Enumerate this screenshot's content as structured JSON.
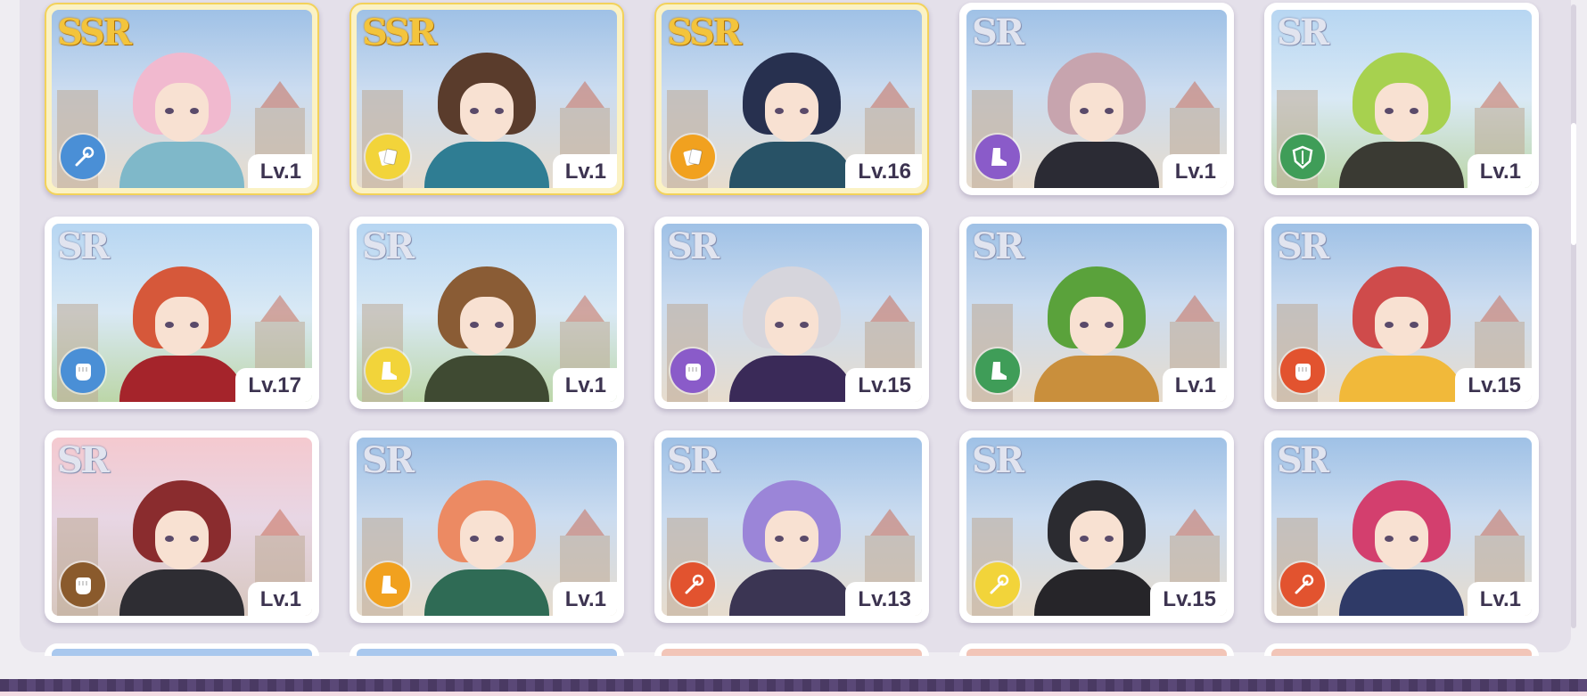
{
  "cards": [
    {
      "rarity": "SSR",
      "level": "Lv.1",
      "element": "blue",
      "role": "staff",
      "hair": "#f1b9cf",
      "outfit": "#7fb8c9",
      "bg": "sky"
    },
    {
      "rarity": "SSR",
      "level": "Lv.1",
      "element": "yellow",
      "role": "cards",
      "hair": "#5a3c2c",
      "outfit": "#2f7d93",
      "bg": "sky"
    },
    {
      "rarity": "SSR",
      "level": "Lv.16",
      "element": "orange",
      "role": "cards",
      "hair": "#27304f",
      "outfit": "#285266",
      "bg": "sky"
    },
    {
      "rarity": "SR",
      "level": "Lv.1",
      "element": "purple",
      "role": "boot",
      "hair": "#c7a4ae",
      "outfit": "#2b2b34",
      "bg": "sky"
    },
    {
      "rarity": "SR",
      "level": "Lv.1",
      "element": "green",
      "role": "shield",
      "hair": "#a7d14f",
      "outfit": "#3a3a33",
      "bg": "sky2"
    },
    {
      "rarity": "SR",
      "level": "Lv.17",
      "element": "blue",
      "role": "fist",
      "hair": "#d6583a",
      "outfit": "#a5242b",
      "bg": "sky2"
    },
    {
      "rarity": "SR",
      "level": "Lv.1",
      "element": "yellow",
      "role": "boot",
      "hair": "#8a5c35",
      "outfit": "#3f4a32",
      "bg": "sky2"
    },
    {
      "rarity": "SR",
      "level": "Lv.15",
      "element": "purple",
      "role": "fist",
      "hair": "#d6d5dc",
      "outfit": "#3a2a58",
      "bg": "sky"
    },
    {
      "rarity": "SR",
      "level": "Lv.1",
      "element": "green",
      "role": "boot",
      "hair": "#5aa23b",
      "outfit": "#c98f3c",
      "bg": "sky"
    },
    {
      "rarity": "SR",
      "level": "Lv.15",
      "element": "red",
      "role": "fist",
      "hair": "#cf4b4b",
      "outfit": "#f1b93a",
      "bg": "sky"
    },
    {
      "rarity": "SR",
      "level": "Lv.1",
      "element": "brown",
      "role": "fist",
      "hair": "#8a2c2e",
      "outfit": "#2e2d33",
      "bg": "warm"
    },
    {
      "rarity": "SR",
      "level": "Lv.1",
      "element": "orange",
      "role": "boot",
      "hair": "#ec8a63",
      "outfit": "#2f6b55",
      "bg": "sky"
    },
    {
      "rarity": "SR",
      "level": "Lv.13",
      "element": "red",
      "role": "staff",
      "hair": "#9b85d8",
      "outfit": "#3b3553",
      "bg": "sky"
    },
    {
      "rarity": "SR",
      "level": "Lv.15",
      "element": "yellow",
      "role": "staff",
      "hair": "#2b2b30",
      "outfit": "#262529",
      "bg": "sky"
    },
    {
      "rarity": "SR",
      "level": "Lv.1",
      "element": "red",
      "role": "staff",
      "hair": "#d33f6e",
      "outfit": "#2f3a67",
      "bg": "sky"
    }
  ],
  "colors": {
    "blue": "#4a8fd6",
    "yellow": "#f2d43a",
    "orange": "#f1a11f",
    "purple": "#8a5bc9",
    "green": "#3f9d58",
    "red": "#e2532f",
    "brown": "#8a5a2c"
  }
}
